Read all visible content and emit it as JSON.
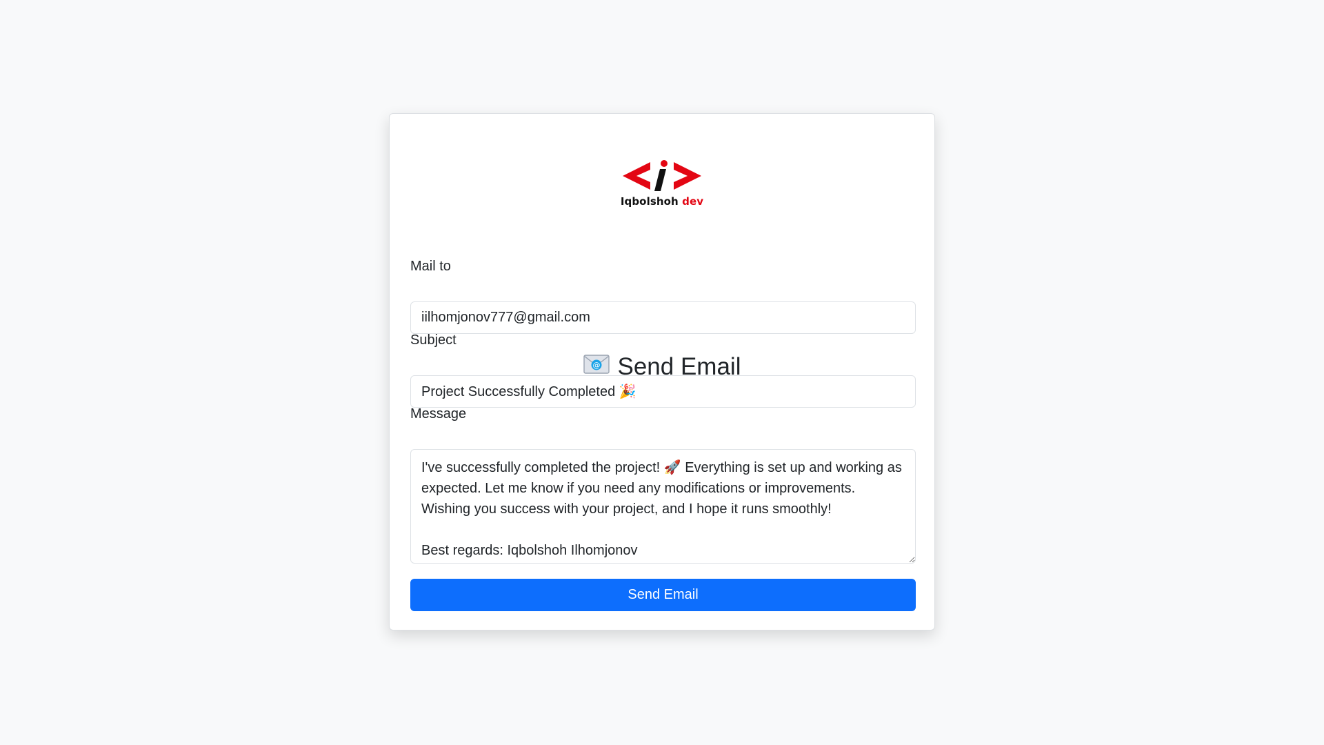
{
  "logo": {
    "name": "Iqbolshoh",
    "suffix": "dev"
  },
  "title": {
    "icon": "envelope-icon",
    "text": "Send Email"
  },
  "form": {
    "mail_to": {
      "label": "Mail to",
      "value": "iilhomjonov777@gmail.com"
    },
    "subject": {
      "label": "Subject",
      "value": "Project Successfully Completed 🎉"
    },
    "message": {
      "label": "Message",
      "value": "I've successfully completed the project! 🚀 Everything is set up and working as expected. Let me know if you need any modifications or improvements. Wishing you success with your project, and I hope it runs smoothly!\n\nBest regards: Iqbolshoh Ilhomjonov"
    },
    "submit_label": "Send Email"
  },
  "colors": {
    "background": "#f8f9fa",
    "primary": "#0d6efd",
    "logo_red": "#e30613"
  }
}
